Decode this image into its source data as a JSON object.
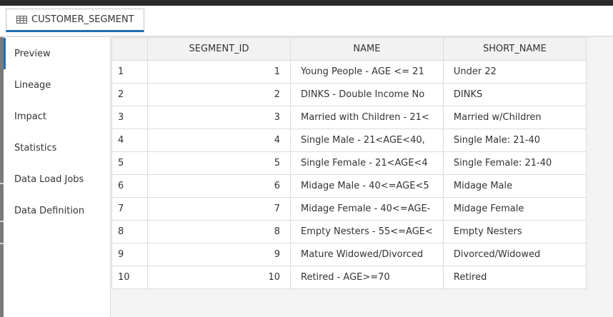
{
  "tab": {
    "label": "CUSTOMER_SEGMENT",
    "icon": "table-icon"
  },
  "sidebar": {
    "items": [
      {
        "label": "Preview"
      },
      {
        "label": "Lineage"
      },
      {
        "label": "Impact"
      },
      {
        "label": "Statistics"
      },
      {
        "label": "Data Load Jobs"
      },
      {
        "label": "Data Definition"
      }
    ]
  },
  "grid": {
    "columns": [
      "",
      "SEGMENT_ID",
      "NAME",
      "SHORT_NAME"
    ],
    "rows": [
      {
        "rownum": "1",
        "segment_id": "1",
        "name": "Young People - AGE <= 21",
        "short_name": "Under 22"
      },
      {
        "rownum": "2",
        "segment_id": "2",
        "name": "DINKS - Double Income No",
        "short_name": "DINKS"
      },
      {
        "rownum": "3",
        "segment_id": "3",
        "name": "Married with Children -  21<",
        "short_name": "Married w/Children"
      },
      {
        "rownum": "4",
        "segment_id": "4",
        "name": "Single Male -  21<AGE<40,",
        "short_name": "Single Male: 21-40"
      },
      {
        "rownum": "5",
        "segment_id": "5",
        "name": "Single Female -  21<AGE<4",
        "short_name": "Single Female: 21-40"
      },
      {
        "rownum": "6",
        "segment_id": "6",
        "name": "Midage Male - 40<=AGE<5",
        "short_name": "Midage Male"
      },
      {
        "rownum": "7",
        "segment_id": "7",
        "name": "Midage Female - 40<=AGE-",
        "short_name": "Midage Female"
      },
      {
        "rownum": "8",
        "segment_id": "8",
        "name": "Empty Nesters - 55<=AGE<",
        "short_name": "Empty Nesters"
      },
      {
        "rownum": "9",
        "segment_id": "9",
        "name": "Mature Widowed/Divorced",
        "short_name": "Divorced/Widowed"
      },
      {
        "rownum": "10",
        "segment_id": "10",
        "name": "Retired - AGE>=70",
        "short_name": "Retired"
      }
    ]
  },
  "colors": {
    "accent": "#1f6fb2",
    "border": "#dcdcdc",
    "header_bg": "#f2f2f2"
  }
}
